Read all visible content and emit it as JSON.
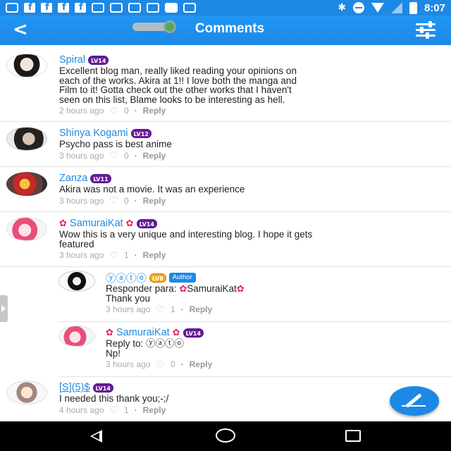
{
  "status_bar": {
    "time": "8:07"
  },
  "app_bar": {
    "title": "Comments"
  },
  "comments": [
    {
      "username": "Spiral",
      "level": "LV14",
      "text_lines": [
        "Excellent blog man, really liked reading your opinions on",
        "each of the works. Akira at 1!! I love both the manga and",
        "Film to it! Gotta check out the other works that I haven't",
        "seen on this list, Blame looks to be interesting as hell."
      ],
      "time": "2 hours ago",
      "likes": "0",
      "reply_label": "Reply"
    },
    {
      "username": "Shinya Kogami",
      "level": "LV12",
      "text_lines": [
        "Psycho pass is best anime"
      ],
      "time": "3 hours ago",
      "likes": "0",
      "reply_label": "Reply"
    },
    {
      "username": "Zanza",
      "level": "LV11",
      "text_lines": [
        "Akira was not a movie. It was an experience"
      ],
      "time": "3 hours ago",
      "likes": "0",
      "reply_label": "Reply"
    },
    {
      "username": "SamuraiKat",
      "level": "LV14",
      "text_lines": [
        "Wow this is a very unique and interesting blog. I hope it gets",
        "featured"
      ],
      "time": "3 hours ago",
      "likes": "1",
      "reply_label": "Reply"
    },
    {
      "username": "ⓨⓐⓣⓞ",
      "level": "LV8",
      "badge": "Author",
      "reply_prefix": "Responder para:",
      "reply_to": "SamuraiKat",
      "text_lines": [
        "Thank you"
      ],
      "time": "3 hours ago",
      "likes": "1",
      "reply_label": "Reply"
    },
    {
      "username": "SamuraiKat",
      "level": "LV14",
      "reply_prefix": "Reply to:",
      "reply_to": "ⓨⓐⓣⓞ",
      "text_lines": [
        "Np!"
      ],
      "time": "3 hours ago",
      "likes": "0",
      "reply_label": "Reply"
    },
    {
      "username": "[S](5)$",
      "level": "LV14",
      "text_lines": [
        "I needed this thank you;-;/"
      ],
      "time": "4 hours ago",
      "likes": "1",
      "reply_label": "Reply"
    }
  ]
}
